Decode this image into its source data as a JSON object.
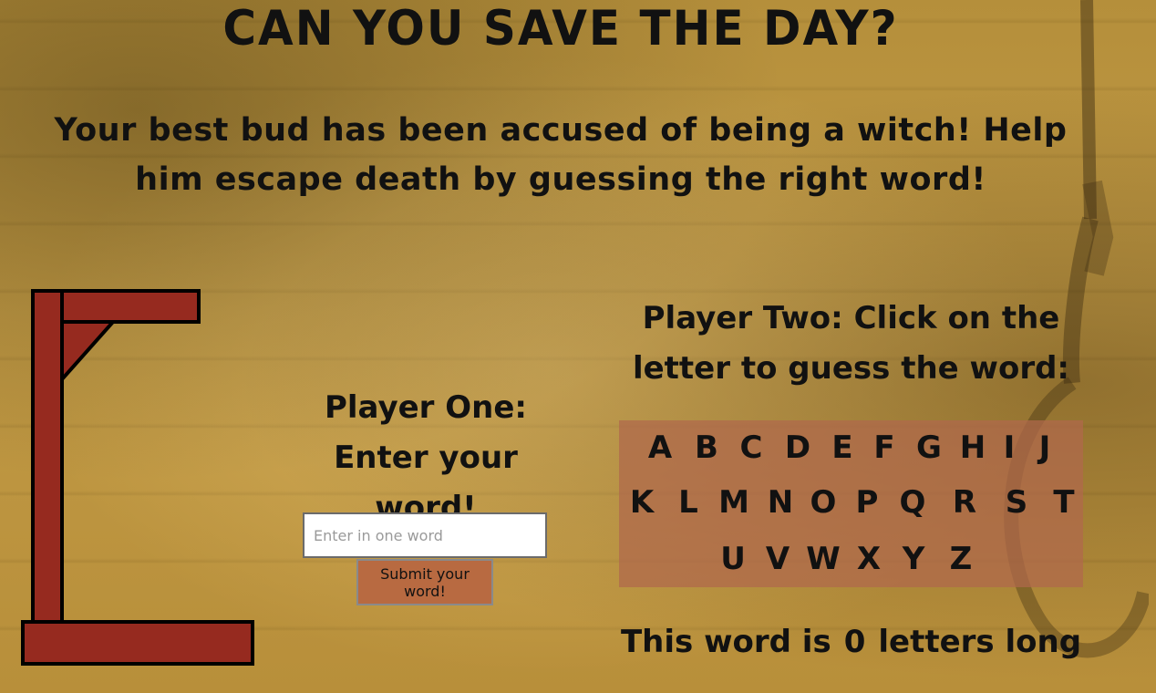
{
  "colors": {
    "background": "#c19a45",
    "gallows": "#962a1f",
    "letters_panel": "#b0684c",
    "submit_button": "#b86a41"
  },
  "header": {
    "title": "CAN YOU SAVE THE DAY?",
    "subtitle": "Your best bud has been accused of being a witch! Help him escape death by guessing the right word!"
  },
  "player_one": {
    "heading": "Player One: Enter your word!",
    "input_placeholder": "Enter in one word",
    "input_value": "",
    "submit_label": "Submit your word!"
  },
  "player_two": {
    "heading": "Player Two: Click on the letter to guess the word:",
    "letter_rows": [
      [
        "A",
        "B",
        "C",
        "D",
        "E",
        "F",
        "G",
        "H",
        "I",
        "J"
      ],
      [
        "K",
        "L",
        "M",
        "N",
        "O",
        "P",
        "Q",
        "R",
        "S",
        "T"
      ],
      [
        "U",
        "V",
        "W",
        "X",
        "Y",
        "Z"
      ]
    ]
  },
  "word_length": {
    "prefix": "This word is",
    "count": "0",
    "suffix": "letters long"
  },
  "icons": {
    "gallows": "gallows-icon",
    "noose": "noose-icon"
  }
}
